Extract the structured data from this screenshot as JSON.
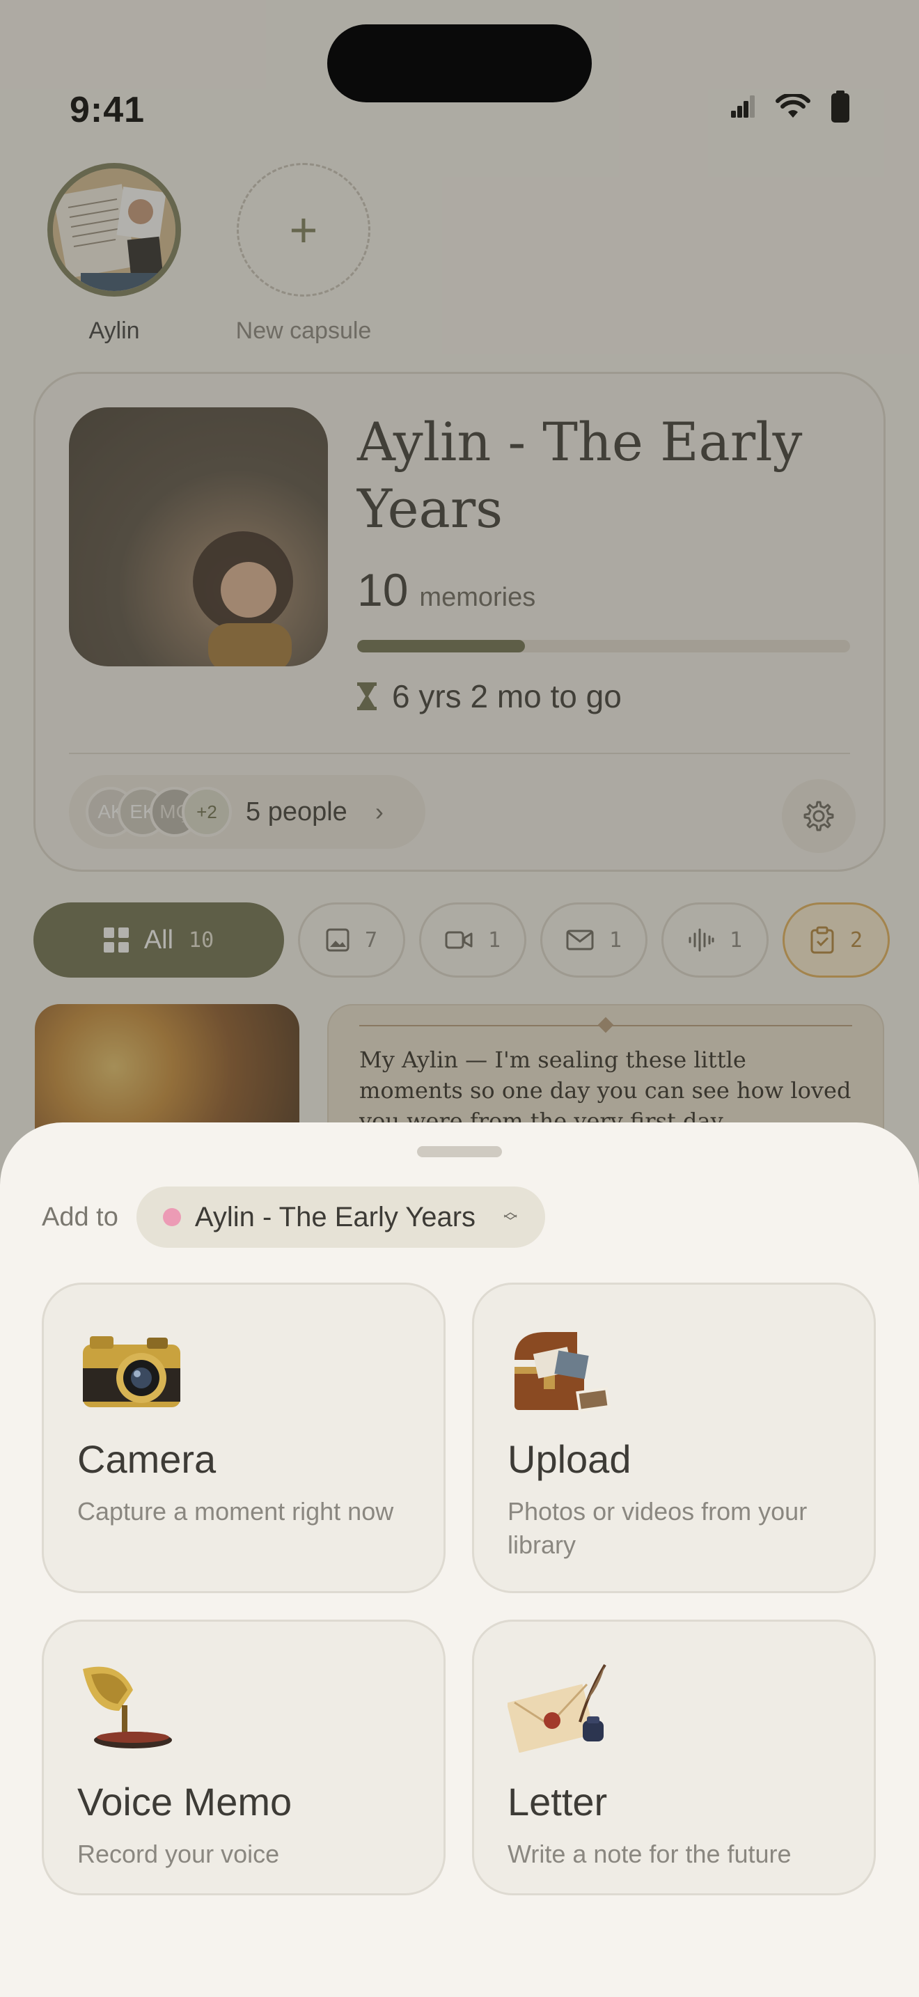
{
  "status_bar": {
    "time": "9:41"
  },
  "capsules": [
    {
      "label": "Aylin"
    },
    {
      "label": "New capsule",
      "icon": "plus-icon"
    }
  ],
  "hero": {
    "title": "Aylin - The Early Years",
    "memories_count": "10",
    "memories_label": "memories",
    "progress_fraction": 0.34,
    "remaining": "6 yrs 2 mo to go",
    "people_text": "5 people",
    "avatars": [
      "AK",
      "EK",
      "MÇ",
      "+2"
    ]
  },
  "filters": [
    {
      "label": "All",
      "count": "10",
      "icon": "grid-icon"
    },
    {
      "count": "7",
      "icon": "photo-icon"
    },
    {
      "count": "1",
      "icon": "video-icon"
    },
    {
      "count": "1",
      "icon": "mail-icon"
    },
    {
      "count": "1",
      "icon": "waveform-icon"
    },
    {
      "count": "2",
      "icon": "clipboard-check-icon"
    }
  ],
  "letter_preview": {
    "text": "My Aylin — I'm sealing these little moments so one day you can see how loved you were from the very first day"
  },
  "sheet": {
    "add_to_label": "Add to",
    "capsule_name": "Aylin - The Early Years",
    "capsule_color": "#ec9bb5",
    "options": [
      {
        "title": "Camera",
        "description": "Capture a moment right now",
        "icon": "camera-icon"
      },
      {
        "title": "Upload",
        "description": "Photos or videos from your library",
        "icon": "treasure-chest-icon"
      },
      {
        "title": "Voice Memo",
        "description": "Record your voice",
        "icon": "gramophone-icon"
      },
      {
        "title": "Letter",
        "description": "Write a note for the future",
        "icon": "sealed-letter-icon"
      }
    ]
  },
  "colors": {
    "accent": "#6f7150",
    "sheet_bg": "#f6f3ee",
    "tasks_chip": "#e5b15b"
  }
}
